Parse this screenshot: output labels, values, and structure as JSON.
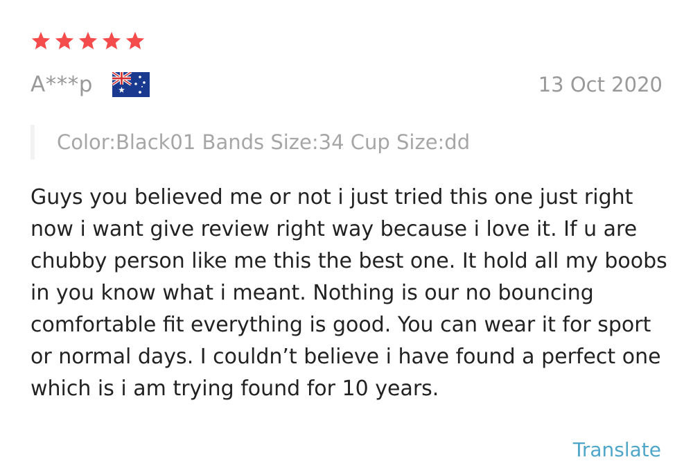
{
  "review": {
    "rating": 5,
    "rating_max": 5,
    "star_color": "#f44c4c",
    "reviewer": "A***p",
    "country_flag_icon": "australia-flag-icon",
    "date": "13 Oct 2020",
    "sku": "Color:Black01 Bands Size:34 Cup Size:dd",
    "text": "Guys you believed me or not i just tried this one just right now i want give review right way because i love it. If u are chubby person like me this the best one. It hold all my boobs in you know what i meant. Nothing is our no bouncing comfortable fit everything is good. You can wear it for sport or normal days. I couldn’t believe i have found a perfect one which is i am trying found for 10 years.",
    "translate_label": "Translate",
    "translate_color": "#4fa6c9"
  }
}
